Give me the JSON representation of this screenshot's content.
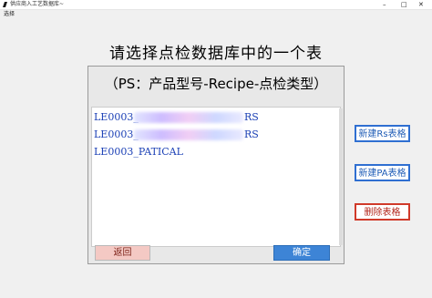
{
  "window": {
    "title": "供应商入工艺数据库~",
    "menu": "选择"
  },
  "page": {
    "heading": "请选择点检数据库中的一个表",
    "subheading": "（PS：产品型号-Recipe-点检类型）"
  },
  "tables": [
    {
      "prefix": "LE0003_",
      "suffix": "RS"
    },
    {
      "prefix": "LE0003_",
      "suffix": "RS"
    },
    {
      "prefix": "LE0003_PATICAL",
      "suffix": ""
    }
  ],
  "buttons": {
    "back": "返回",
    "confirm": "确定",
    "new_rs": "新建Rs表格",
    "new_pa": "新建PA表格",
    "delete": "删除表格"
  },
  "colors": {
    "list_text": "#1a3fb5",
    "confirm_bg": "#3d84d6",
    "back_bg": "#f4c9c4",
    "accent_blue": "#2f6fd1",
    "accent_red": "#d03a2a"
  }
}
